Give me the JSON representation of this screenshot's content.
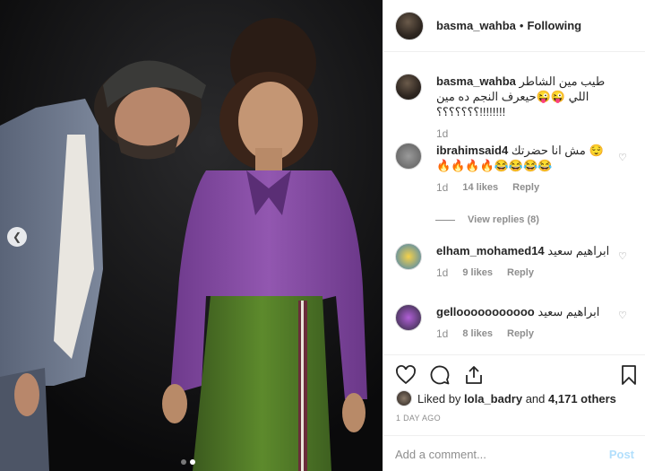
{
  "header": {
    "username": "basma_wahba",
    "separator": "•",
    "follow_label": "Following"
  },
  "caption": {
    "username": "basma_wahba",
    "text": "طيب مين الشاطر اللي 😜😜حيعرف النجم ده مين !!!!!!!!؟؟؟؟؟؟؟",
    "time": "1d"
  },
  "comments": [
    {
      "username": "ibrahimsaid4",
      "text": "مش انا حضرتك 😌 🔥🔥🔥🔥😂😂😂😂",
      "time": "1d",
      "likes": "14 likes",
      "reply_label": "Reply"
    },
    {
      "username": "elham_mohamed14",
      "text": "ابراهيم سعيد",
      "time": "1d",
      "likes": "9 likes",
      "reply_label": "Reply"
    },
    {
      "username": "gellooooooooooo",
      "text": "ابراهيم سعيد",
      "time": "1d",
      "likes": "8 likes",
      "reply_label": "Reply"
    }
  ],
  "view_replies": "View replies (8)",
  "liked_by": {
    "prefix": "Liked by",
    "user": "lola_badry",
    "connector": "and",
    "others": "4,171 others"
  },
  "posted_time": "1 DAY AGO",
  "add_comment": {
    "placeholder": "Add a comment...",
    "post_label": "Post"
  },
  "icons": {
    "like": "heart-icon",
    "comment": "comment-icon",
    "share": "share-icon",
    "save": "bookmark-icon",
    "prev": "chevron-left-icon"
  },
  "colors": {
    "post_button": "#b2dffc",
    "muted": "#8e8e8e",
    "text": "#262626",
    "border": "#efefef"
  },
  "carousel": {
    "slides": 2,
    "active_index": 1
  }
}
